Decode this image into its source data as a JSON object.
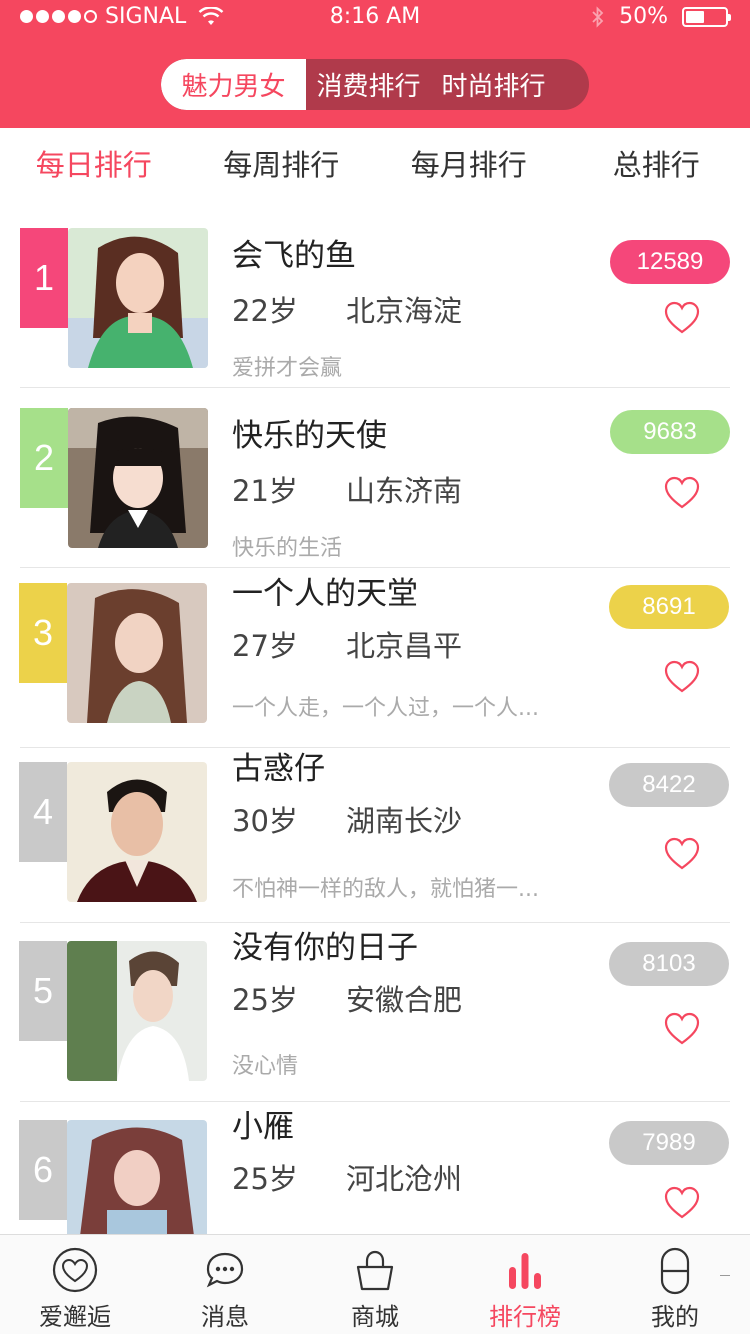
{
  "status_bar": {
    "carrier": "SIGNAL",
    "time": "8:16 AM",
    "battery": "50%"
  },
  "segments": [
    "魅力男女",
    "消费排行",
    "时尚排行"
  ],
  "subtabs": [
    "每日排行",
    "每周排行",
    "每月排行",
    "总排行"
  ],
  "rows": [
    {
      "rank": "1",
      "name": "会飞的鱼",
      "age": "22岁",
      "city": "北京海淀",
      "motto": "爱拼才会赢",
      "score": "12589",
      "color": "#f5477a"
    },
    {
      "rank": "2",
      "name": "快乐的天使",
      "age": "21岁",
      "city": "山东济南",
      "motto": "快乐的生活",
      "score": "9683",
      "color": "#a6e08a"
    },
    {
      "rank": "3",
      "name": "一个人的天堂",
      "age": "27岁",
      "city": "北京昌平",
      "motto": "一个人走，一个人过，一个人...",
      "score": "8691",
      "color": "#ecd24a"
    },
    {
      "rank": "4",
      "name": "古惑仔",
      "age": "30岁",
      "city": "湖南长沙",
      "motto": "不怕神一样的敌人，就怕猪一...",
      "score": "8422",
      "color": "#c9c9c9"
    },
    {
      "rank": "5",
      "name": "没有你的日子",
      "age": "25岁",
      "city": "安徽合肥",
      "motto": "没心情",
      "score": "8103",
      "color": "#c9c9c9"
    },
    {
      "rank": "6",
      "name": "小雁",
      "age": "25岁",
      "city": "河北沧州",
      "motto": "",
      "score": "7989",
      "color": "#c9c9c9"
    }
  ],
  "tabbar": [
    {
      "label": "爱邂逅",
      "icon": "heart-circle-icon"
    },
    {
      "label": "消息",
      "icon": "chat-bubbles-icon"
    },
    {
      "label": "商城",
      "icon": "shopping-bag-icon"
    },
    {
      "label": "排行榜",
      "icon": "bar-chart-icon"
    },
    {
      "label": "我的",
      "icon": "person-icon"
    }
  ],
  "colors": {
    "accent": "#f5475f",
    "heart": "#f5475f"
  }
}
